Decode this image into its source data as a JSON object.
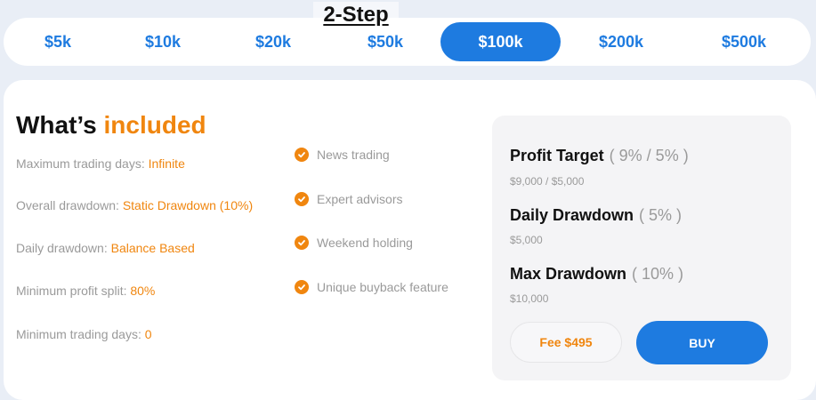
{
  "header": {
    "title": "2-Step"
  },
  "tabs": [
    {
      "label": "$5k",
      "active": false
    },
    {
      "label": "$10k",
      "active": false
    },
    {
      "label": "$20k",
      "active": false
    },
    {
      "label": "$50k",
      "active": false
    },
    {
      "label": "$100k",
      "active": true
    },
    {
      "label": "$200k",
      "active": false
    },
    {
      "label": "$500k",
      "active": false
    }
  ],
  "included": {
    "heading_prefix": "What’s",
    "heading_accent": "included",
    "details": [
      {
        "label": "Maximum trading days: ",
        "value": "Infinite"
      },
      {
        "label": "Overall drawdown: ",
        "value": "Static Drawdown (10%)"
      },
      {
        "label": "Daily drawdown: ",
        "value": "Balance Based"
      },
      {
        "label": "Minimum profit split: ",
        "value": "80%"
      },
      {
        "label": "Minimum trading days: ",
        "value": "0"
      }
    ],
    "features": [
      "News trading",
      "Expert advisors",
      "Weekend holding",
      "Unique buyback feature"
    ]
  },
  "targets": {
    "profit_target": {
      "title": "Profit Target",
      "percent": "( 9% / 5% )",
      "amount": "$9,000 / $5,000"
    },
    "daily_drawdown": {
      "title": "Daily Drawdown",
      "percent": "( 5% )",
      "amount": "$5,000"
    },
    "max_drawdown": {
      "title": "Max Drawdown",
      "percent": "( 10% )",
      "amount": "$10,000"
    }
  },
  "actions": {
    "fee_label": "Fee $495",
    "buy_label": "BUY"
  },
  "colors": {
    "accent": "#f0860f",
    "brand": "#1e7be0"
  },
  "icons": {
    "feature_check": "check-circle-icon"
  }
}
